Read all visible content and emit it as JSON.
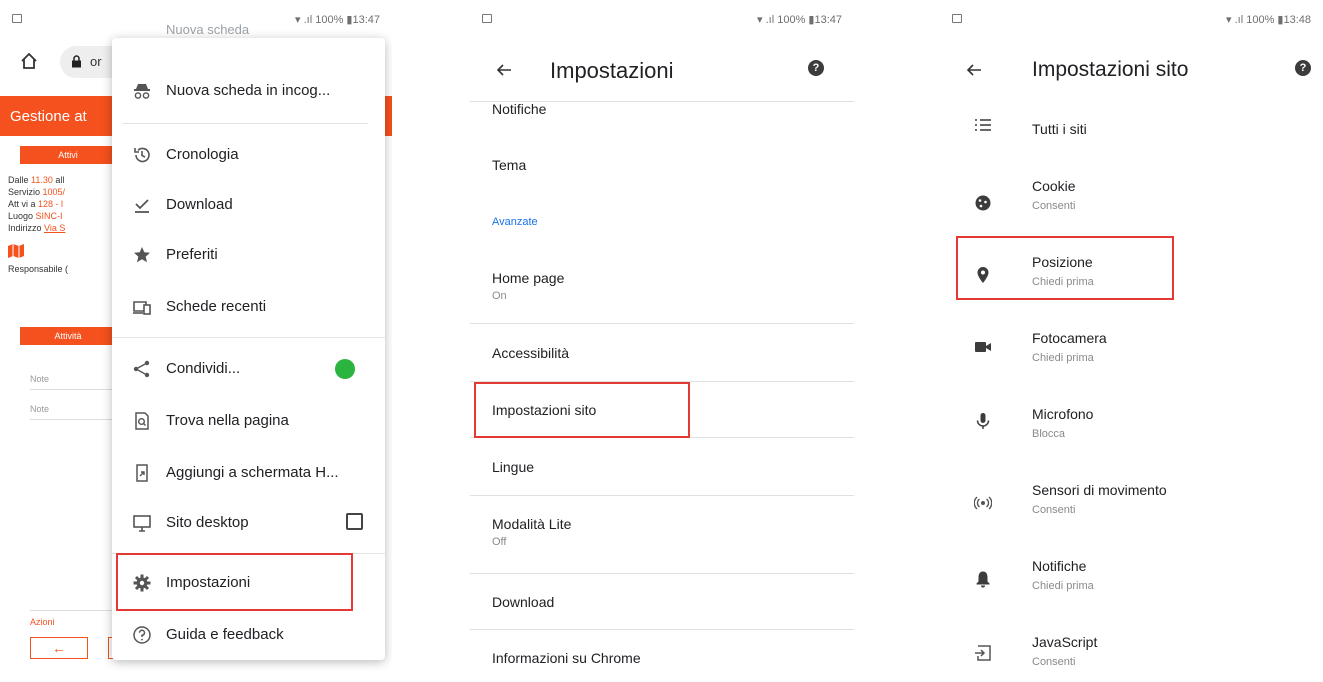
{
  "status_bar": {
    "left_text": "100%",
    "time_1": "13:47",
    "time_2": "13:47",
    "time_3": "13:48"
  },
  "panel1": {
    "url_text": "or",
    "site": {
      "header_title": "Gestione at",
      "top_button": "Attivi",
      "lines": [
        {
          "label": "Dalle ",
          "value": "11.30",
          "rest": " all"
        },
        {
          "label": "Servizio ",
          "value": "1005/"
        },
        {
          "label": "Att vi a ",
          "value": "128 - l"
        },
        {
          "label": "Luogo ",
          "value": "SINC-I"
        },
        {
          "label": "Indirizzo ",
          "value": "Via S"
        }
      ],
      "responsible": "Responsabile (",
      "action_button": "Attività",
      "notes": [
        "Note",
        "Note"
      ],
      "azioni_label": "Azioni",
      "back_arrow": "←"
    },
    "menu": {
      "partial_item": "Nuova scheda",
      "items": [
        {
          "label": "Nuova scheda in incog...",
          "icon": "incognito-icon"
        },
        {
          "label": "Cronologia",
          "icon": "history-icon"
        },
        {
          "label": "Download",
          "icon": "download-icon"
        },
        {
          "label": "Preferiti",
          "icon": "star-icon"
        },
        {
          "label": "Schede recenti",
          "icon": "devices-icon"
        },
        {
          "label": "Condividi...",
          "icon": "share-icon"
        },
        {
          "label": "Trova nella pagina",
          "icon": "find-icon"
        },
        {
          "label": "Aggiungi a schermata H...",
          "icon": "add-home-icon"
        },
        {
          "label": "Sito desktop",
          "icon": "desktop-icon"
        },
        {
          "label": "Impostazioni",
          "icon": "gear-icon"
        },
        {
          "label": "Guida e feedback",
          "icon": "help-circle-icon"
        }
      ],
      "highlighted": "Impostazioni"
    }
  },
  "panel2": {
    "title": "Impostazioni",
    "help_glyph": "?",
    "partial_item": "Notifiche",
    "items": [
      {
        "title": "Tema",
        "subtitle": ""
      },
      {
        "title": "Home page",
        "subtitle": "On"
      },
      {
        "title": "Accessibilità",
        "subtitle": ""
      },
      {
        "title": "Impostazioni sito",
        "subtitle": ""
      },
      {
        "title": "Lingue",
        "subtitle": ""
      },
      {
        "title": "Modalità Lite",
        "subtitle": "Off"
      },
      {
        "title": "Download",
        "subtitle": ""
      },
      {
        "title": "Informazioni su Chrome",
        "subtitle": ""
      }
    ],
    "section_label": "Avanzate",
    "highlighted": "Impostazioni sito"
  },
  "panel3": {
    "title": "Impostazioni sito",
    "help_glyph": "?",
    "items": [
      {
        "title": "Tutti i siti",
        "subtitle": "",
        "icon": "list-icon"
      },
      {
        "title": "Cookie",
        "subtitle": "Consenti",
        "icon": "cookie-icon"
      },
      {
        "title": "Posizione",
        "subtitle": "Chiedi prima",
        "icon": "location-pin-icon"
      },
      {
        "title": "Fotocamera",
        "subtitle": "Chiedi prima",
        "icon": "camera-icon"
      },
      {
        "title": "Microfono",
        "subtitle": "Blocca",
        "icon": "microphone-icon"
      },
      {
        "title": "Sensori di movimento",
        "subtitle": "Consenti",
        "icon": "motion-sensor-icon"
      },
      {
        "title": "Notifiche",
        "subtitle": "Chiedi prima",
        "icon": "bell-icon"
      },
      {
        "title": "JavaScript",
        "subtitle": "Consenti",
        "icon": "javascript-icon"
      }
    ],
    "highlighted": "Posizione"
  },
  "colors": {
    "accent_orange": "#f4511e",
    "link_blue": "#1a73e8",
    "highlight_red": "#e53935",
    "whatsapp_green": "#2bb540"
  }
}
